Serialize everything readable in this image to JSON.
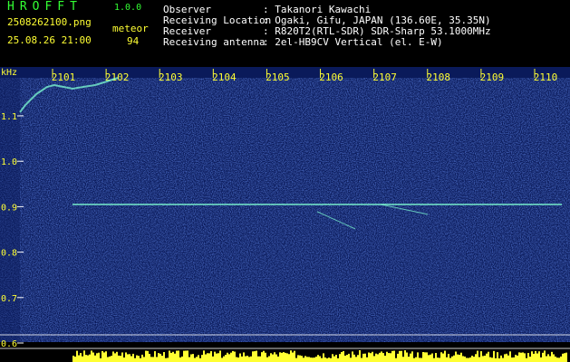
{
  "header": {
    "app_title": "HROFFT",
    "app_version": "1.0.0",
    "file_name": "2508262100.png",
    "date_time": "25.08.26 21:00",
    "mode": "meteor",
    "count": "94"
  },
  "info": [
    {
      "label": "Observer",
      "value": ": Takanori Kawachi"
    },
    {
      "label": "Receiving Location",
      "value": ": Ogaki, Gifu, JAPAN (136.60E, 35.35N)"
    },
    {
      "label": "Receiver",
      "value": ": R820T2(RTL-SDR) SDR-Sharp 53.1000MHz"
    },
    {
      "label": "Receiving antenna",
      "value": ": 2el-HB9CV Vertical (el. E-W)"
    }
  ],
  "chart_data": {
    "type": "heatmap",
    "y_unit": "kHz",
    "x_ticks": [
      "2101",
      "2102",
      "2103",
      "2104",
      "2105",
      "2106",
      "2107",
      "2108",
      "2109",
      "2110"
    ],
    "y_ticks": [
      "1.1",
      "1.0",
      "0.9",
      "0.8",
      "0.7",
      "0.6"
    ],
    "y_values": [
      1.1,
      1.0,
      0.9,
      0.8,
      0.7,
      0.6
    ],
    "carrier_khz": 0.905,
    "colors": {
      "background": "#0a1a5a",
      "noise": "#3050c0",
      "signal": "#7fffd4",
      "axis_text": "#ffff33",
      "grid": "#ffffff"
    }
  }
}
